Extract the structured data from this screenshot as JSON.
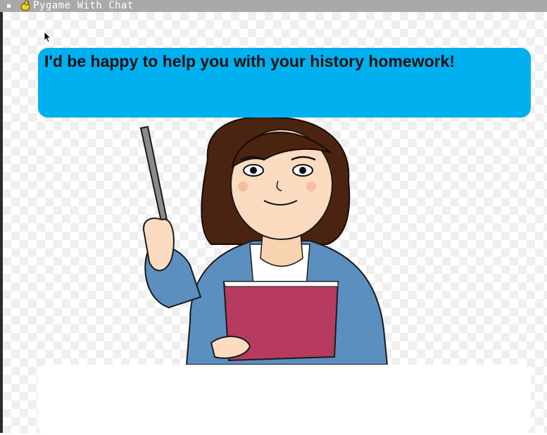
{
  "window": {
    "title": "Pygame With Chat"
  },
  "chat": {
    "message": "I'd be happy to help you with your history homework!",
    "input_value": ""
  },
  "icons": {
    "window_menu": "window-menu-icon",
    "app": "pygame-snake-icon",
    "pointer": "mouse-pointer-icon"
  },
  "colors": {
    "titlebar": "#a9a9a9",
    "bubble": "#00b0ef",
    "input_box": "#ffffff"
  }
}
